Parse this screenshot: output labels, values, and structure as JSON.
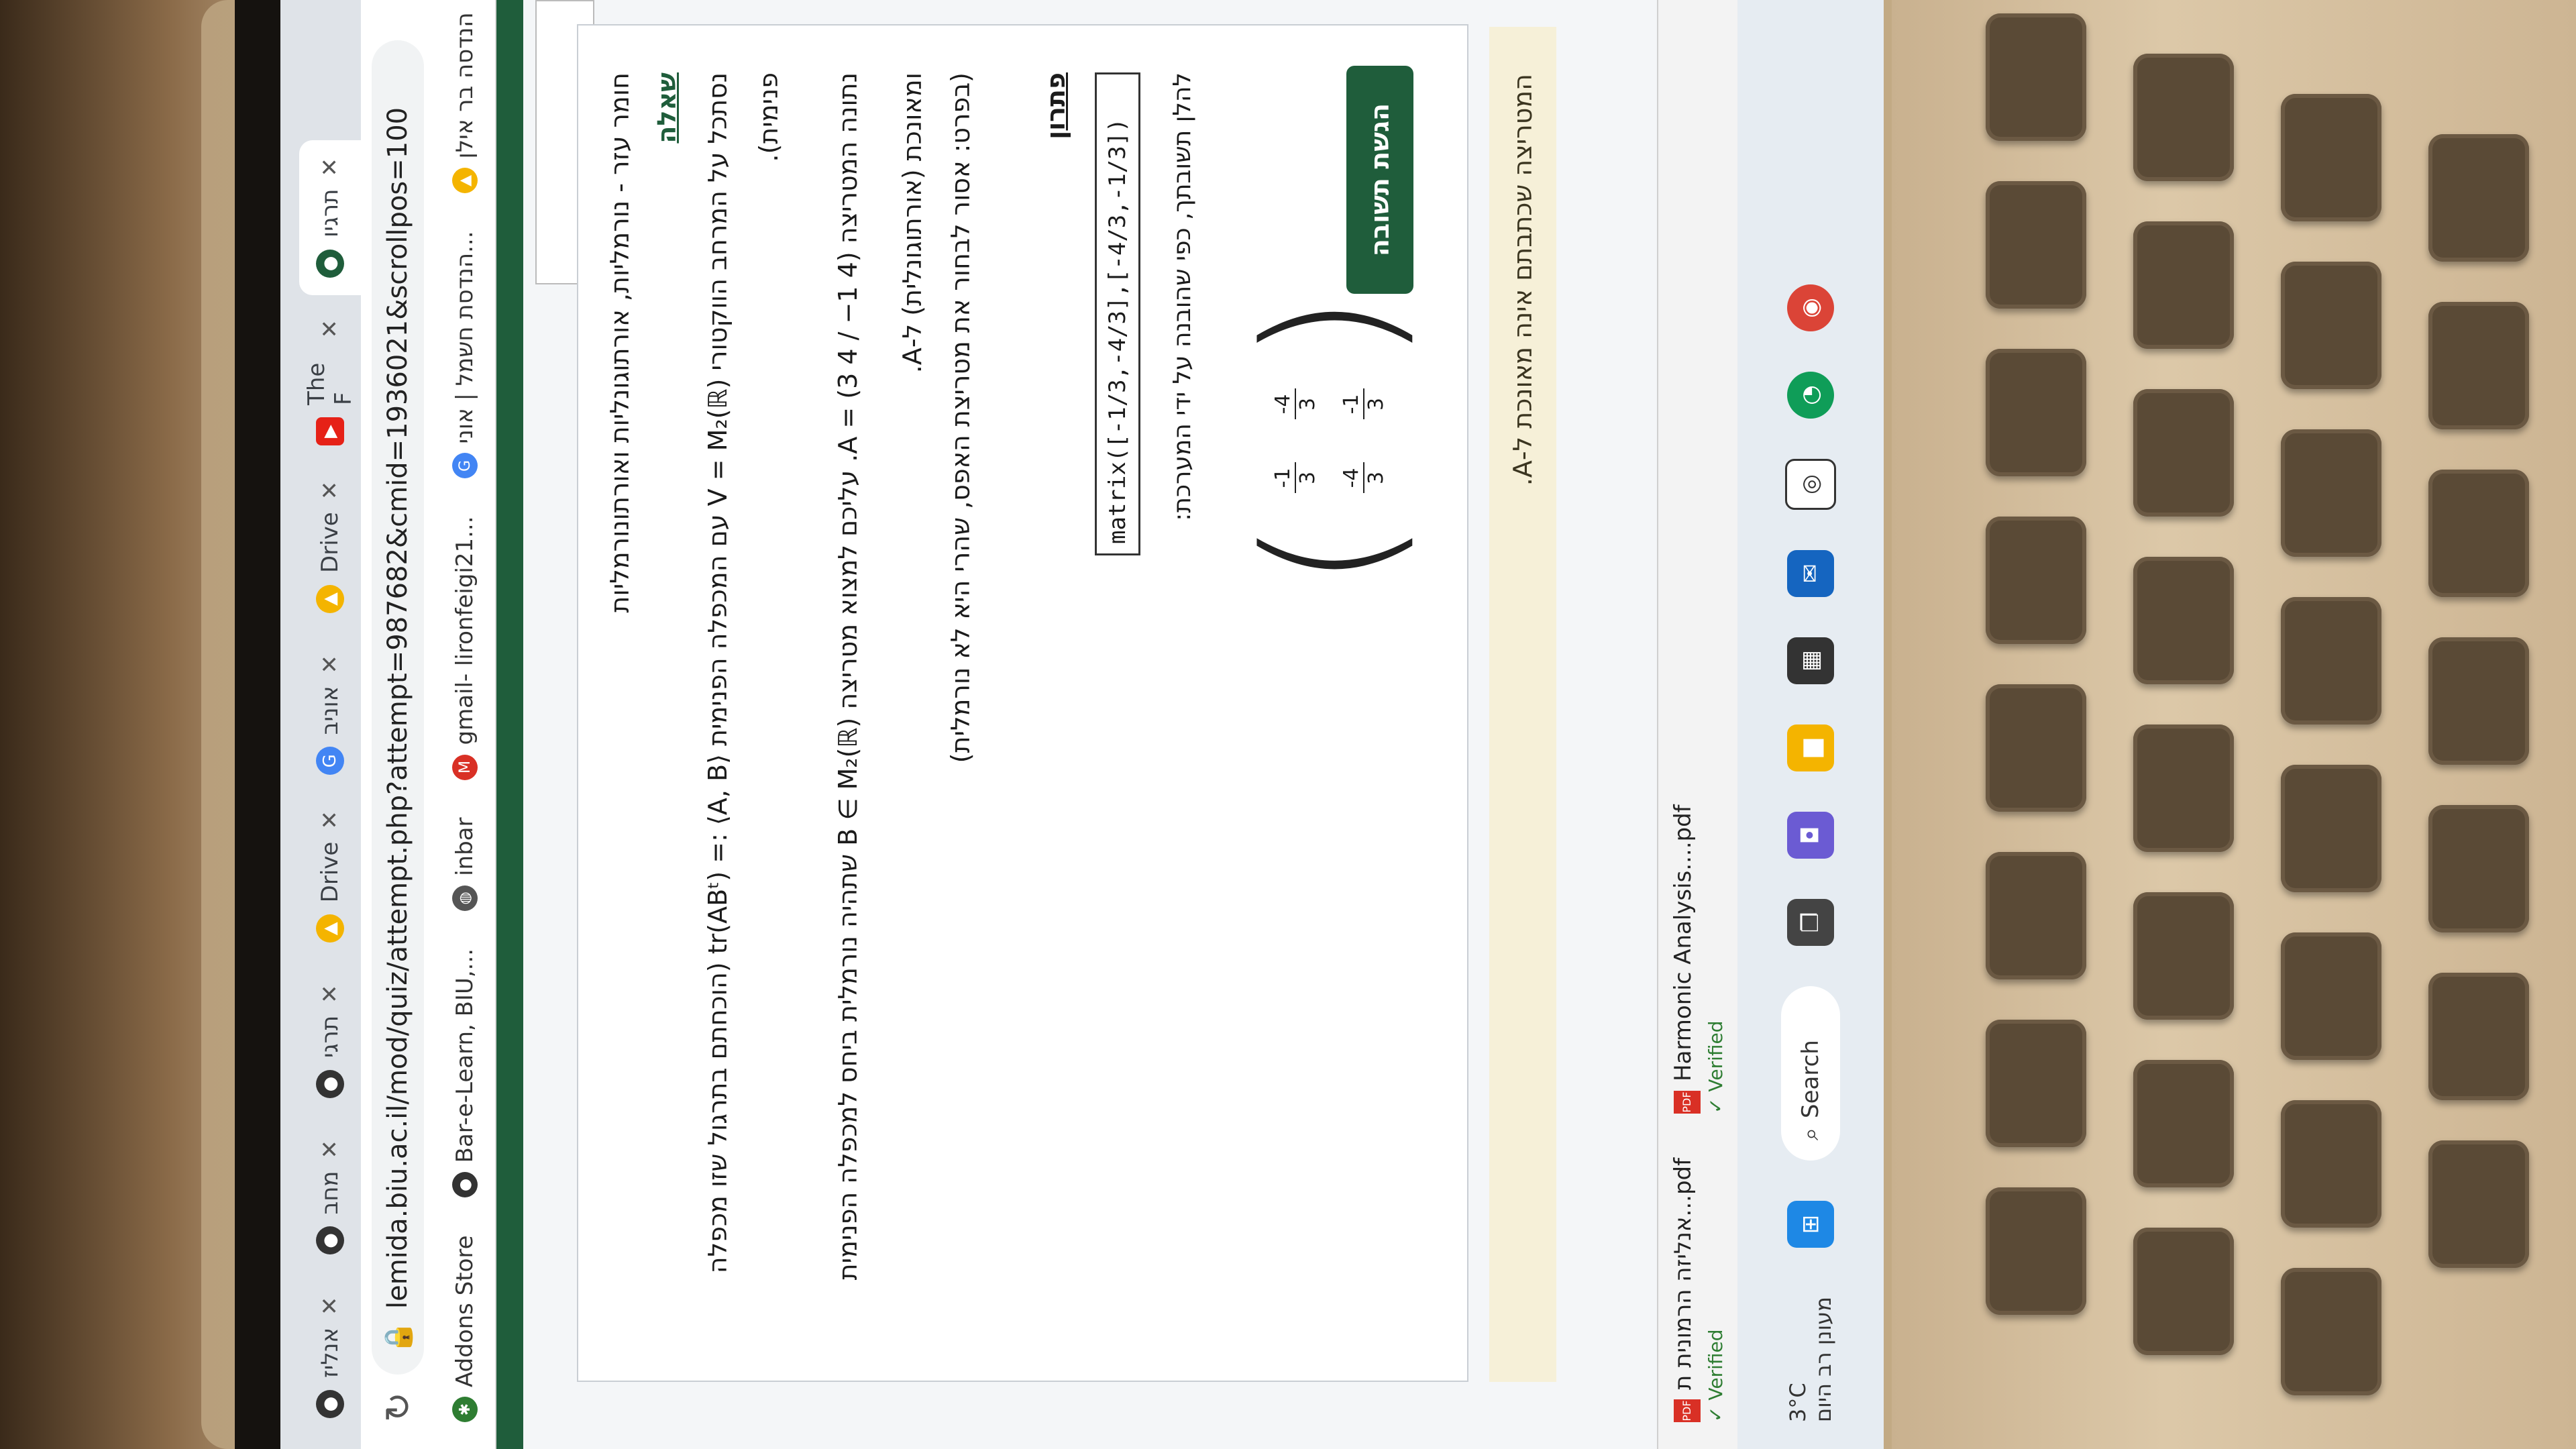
{
  "browser": {
    "tabs": [
      {
        "label": "אנליז",
        "icon": "moodle-icon",
        "active": false
      },
      {
        "label": "מחב",
        "icon": "moodle-icon",
        "active": false
      },
      {
        "label": "תרגי",
        "icon": "moodle-icon",
        "active": false
      },
      {
        "label": "Drive",
        "icon": "drive-icon",
        "active": false
      },
      {
        "label": "אוניב",
        "icon": "google-icon",
        "active": false
      },
      {
        "label": "Drive",
        "icon": "drive-icon",
        "active": false
      },
      {
        "label": "The F",
        "icon": "youtube-icon",
        "active": false
      },
      {
        "label": "תרגיו",
        "icon": "moodle-icon",
        "active": true
      }
    ],
    "url": "lemida.biu.ac.il/mod/quiz/attempt.php?attempt=987682&cmid=1936021&scrollpos=100",
    "bookmarks": [
      {
        "label": "Addons Store",
        "icon": "addons-icon"
      },
      {
        "label": "Bar-e-Learn, BIU,...",
        "icon": "moodle-icon"
      },
      {
        "label": "inbar",
        "icon": "globe-icon"
      },
      {
        "label": "gmail- lironfeigi21...",
        "icon": "gmail-icon"
      },
      {
        "label": "הנדסת חשמל | אוני...",
        "icon": "google-icon"
      },
      {
        "label": "הנדסה בר אילן",
        "icon": "drive-icon"
      }
    ]
  },
  "question": {
    "title": "חומר עזר - נורמליות, אורתוגונליות ואורתונורמליות",
    "heading": "שאלה",
    "line1": "נסתכל על המרחב הווקטורי V = M₂(ℝ) עם המכפלה הפנימית ⟨A, B⟩ := tr(ABᵗ) (הוכחתם בתרגול שזו מכפלה",
    "line1b": "פנימית).",
    "line2": "נתונה המטריצה A = (3 4 / −1 4). עליכם למצוא מטריצה B ∈ M₂(ℝ) שתהיה נורמלית ביחס למכפלה הפנימית",
    "line3": "ומאונכת (אורתוגונלית) ל-A.",
    "line4": "(בפרט: אסור לבחור את מטריצת האפס, שהרי היא לא נורמלית)",
    "answer_heading": "פתרון",
    "answer_value": "matrix([-1/3,-4/3],[-4/3,-1/3])",
    "preview_label": "להלן תשובתך, כפי שהובנה על ידי המערכת:",
    "matrix": [
      [
        "-1",
        "3"
      ],
      [
        "-4",
        "3"
      ],
      [
        "-4",
        "3"
      ],
      [
        "-1",
        "3"
      ]
    ],
    "submit_label": "הגשת תשובה",
    "feedback": "המטריצה שכתבתם אינה מאונכת ל-A."
  },
  "downloads": [
    {
      "name": "אנליזה הרמונית ת...pdf",
      "status": "✓ Verified"
    },
    {
      "name": "Harmonic Analysis....pdf",
      "status": "✓ Verified"
    }
  ],
  "taskbar": {
    "weather_temp": "3°C",
    "weather_desc": "מעונן רב היום",
    "search_label": "Search"
  }
}
